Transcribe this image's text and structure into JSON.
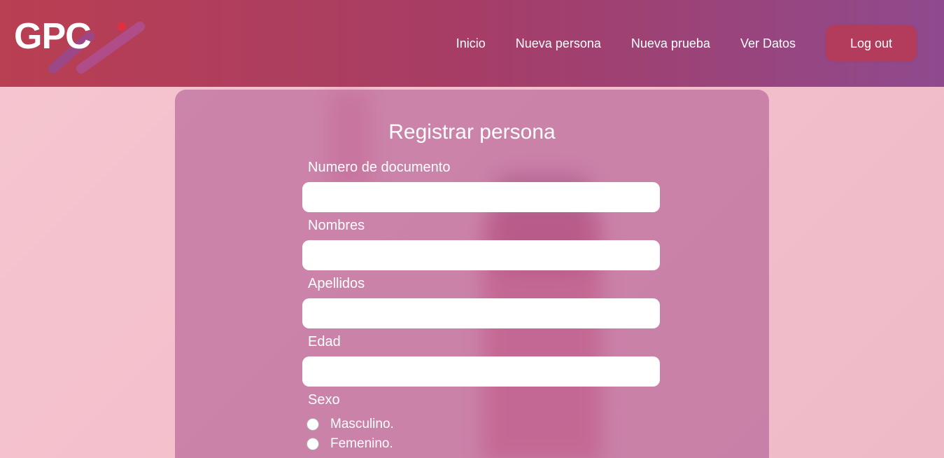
{
  "brand": {
    "logo_text": "GPC"
  },
  "nav": {
    "items": [
      "Inicio",
      "Nueva persona",
      "Nueva prueba",
      "Ver Datos"
    ],
    "logout_label": "Log out"
  },
  "form": {
    "title": "Registrar persona",
    "fields": [
      {
        "label": "Numero de documento",
        "value": "",
        "placeholder": ""
      },
      {
        "label": "Nombres",
        "value": "",
        "placeholder": ""
      },
      {
        "label": "Apellidos",
        "value": "",
        "placeholder": ""
      },
      {
        "label": "Edad",
        "value": "",
        "placeholder": ""
      }
    ],
    "sexo_label": "Sexo",
    "sexo_options": [
      "Masculino.",
      "Femenino."
    ]
  },
  "colors": {
    "header_start": "#b93f52",
    "header_end": "#8f4a8e",
    "logout_bg": "#b33c5d",
    "card_bg": "rgba(170,80,140,0.55)",
    "page_bg": "#f3bfcc"
  }
}
